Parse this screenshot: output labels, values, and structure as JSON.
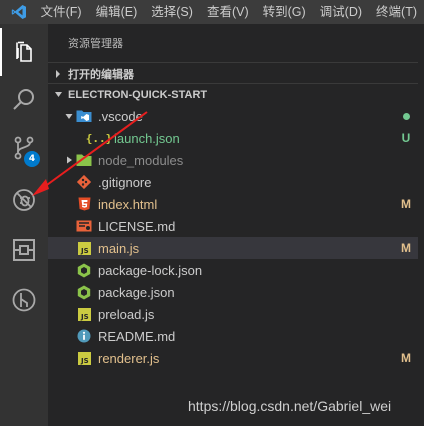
{
  "menu": [
    "文件(F)",
    "编辑(E)",
    "选择(S)",
    "查看(V)",
    "转到(G)",
    "调试(D)",
    "终端(T)"
  ],
  "sidebar": {
    "title": "资源管理器",
    "open_editors": "打开的编辑器",
    "project": "ELECTRON-QUICK-START"
  },
  "activity": {
    "scm_badge": "4"
  },
  "files": [
    {
      "name": ".vscode",
      "icon": "vscode-folder-icon",
      "status": "dot",
      "color": "white"
    },
    {
      "name": "launch.json",
      "icon": "json-icon",
      "status": "U",
      "color": "green"
    },
    {
      "name": "node_modules",
      "icon": "node-folder-icon",
      "status": "",
      "color": "gray"
    },
    {
      "name": ".gitignore",
      "icon": "git-icon",
      "status": "",
      "color": "white"
    },
    {
      "name": "index.html",
      "icon": "html-icon",
      "status": "M",
      "color": "yellow"
    },
    {
      "name": "LICENSE.md",
      "icon": "license-icon",
      "status": "",
      "color": "white"
    },
    {
      "name": "main.js",
      "icon": "js-icon",
      "status": "M",
      "color": "yellow"
    },
    {
      "name": "package-lock.json",
      "icon": "node-file-icon",
      "status": "",
      "color": "white"
    },
    {
      "name": "package.json",
      "icon": "node-file-icon",
      "status": "",
      "color": "white"
    },
    {
      "name": "preload.js",
      "icon": "js-icon",
      "status": "",
      "color": "white"
    },
    {
      "name": "README.md",
      "icon": "info-icon",
      "status": "",
      "color": "white"
    },
    {
      "name": "renderer.js",
      "icon": "js-icon",
      "status": "M",
      "color": "yellow"
    }
  ],
  "watermark": "https://blog.csdn.net/Gabriel_wei",
  "colors": {
    "accent": "#007acc",
    "modified": "#e2c08d",
    "untracked": "#73c991",
    "arrow": "#e81e1e"
  }
}
